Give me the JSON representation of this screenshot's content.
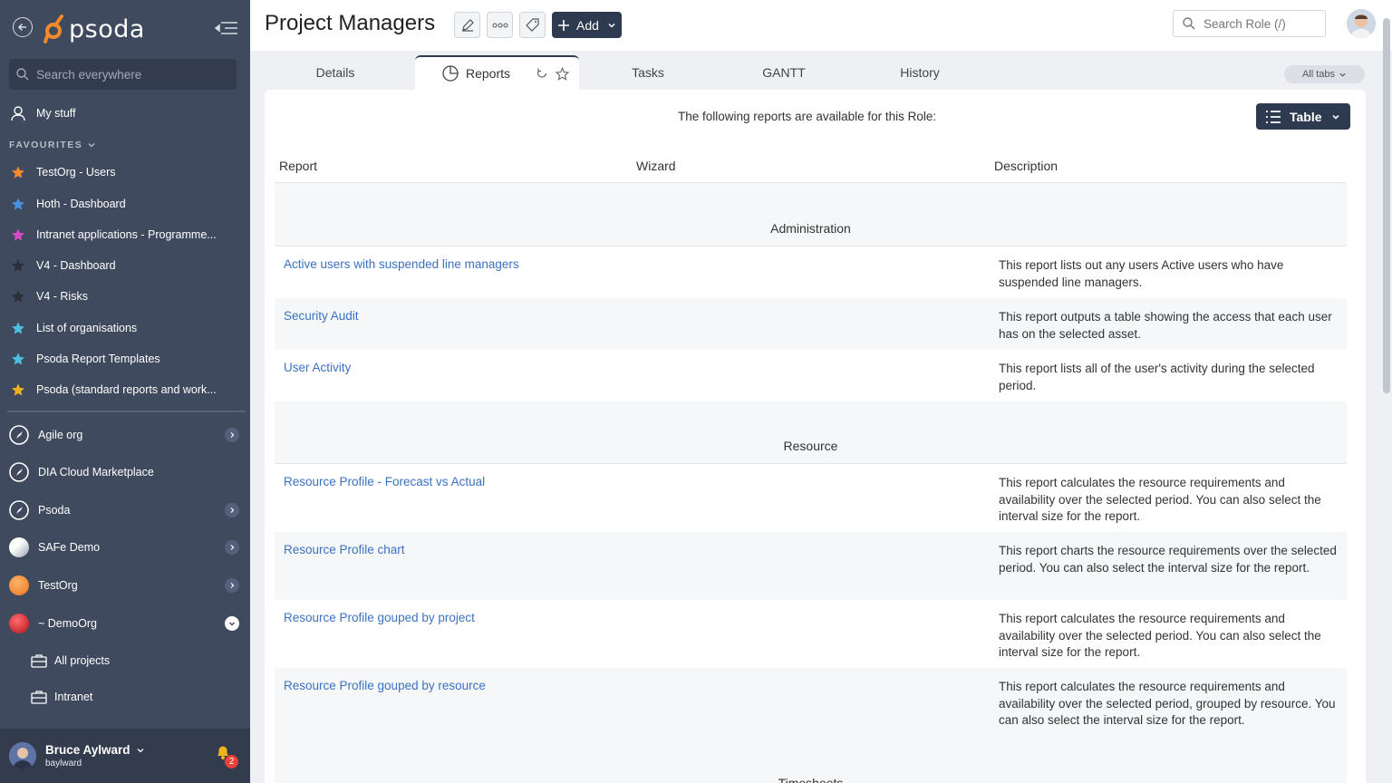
{
  "sidebar": {
    "logo": "psoda",
    "search_placeholder": "Search everywhere",
    "my_stuff": "My stuff",
    "favourites_label": "FAVOURITES",
    "favourites": [
      {
        "label": "TestOrg - Users",
        "color": "#f08a2c"
      },
      {
        "label": "Hoth - Dashboard",
        "color": "#4a8fe0"
      },
      {
        "label": "Intranet applications - Programme...",
        "color": "#d849c6"
      },
      {
        "label": "V4 - Dashboard",
        "color": "#2b2f37"
      },
      {
        "label": "V4 - Risks",
        "color": "#2b2f37"
      },
      {
        "label": "List of organisations",
        "color": "#4bbfe0"
      },
      {
        "label": "Psoda Report Templates",
        "color": "#4bbfe0"
      },
      {
        "label": "Psoda (standard reports and work...",
        "color": "#f0b21c"
      }
    ],
    "orgs": [
      {
        "label": "Agile org",
        "has_arrow": true
      },
      {
        "label": "DIA Cloud Marketplace",
        "has_arrow": false
      },
      {
        "label": "Psoda",
        "has_arrow": true
      },
      {
        "label": "SAFe Demo",
        "has_arrow": true
      },
      {
        "label": "TestOrg",
        "has_arrow": true
      },
      {
        "label": "~ DemoOrg",
        "has_arrow": true,
        "expanded": true
      }
    ],
    "sub_items": [
      {
        "label": "All projects"
      },
      {
        "label": "Intranet"
      }
    ],
    "user": {
      "name": "Bruce Aylward",
      "username": "baylward"
    },
    "notifications": "2"
  },
  "header": {
    "title": "Project Managers",
    "add_label": "Add",
    "search_placeholder": "Search Role (/)"
  },
  "tabs": [
    {
      "label": "Details"
    },
    {
      "label": "Reports",
      "active": true
    },
    {
      "label": "Tasks"
    },
    {
      "label": "GANTT"
    },
    {
      "label": "History"
    }
  ],
  "all_tabs_label": "All tabs",
  "content": {
    "intro": "The following reports are available for this Role:",
    "view_label": "Table",
    "columns": [
      "Report",
      "Wizard",
      "Description"
    ],
    "sections": [
      {
        "name": "Administration",
        "reports": [
          {
            "name": "Active users with suspended line managers",
            "description": "This report lists out any users Active users who have suspended line managers."
          },
          {
            "name": "Security Audit",
            "description": "This report outputs a table showing the access that each user has on the selected asset."
          },
          {
            "name": "User Activity",
            "description": "This report lists all of the user's activity during the selected period."
          }
        ]
      },
      {
        "name": "Resource",
        "reports": [
          {
            "name": "Resource Profile - Forecast vs Actual",
            "description": "This report calculates the resource requirements and availability over the selected period. You can also select the interval size for the report."
          },
          {
            "name": "Resource Profile chart",
            "description": "This report charts the resource requirements over the selected period. You can also select the interval size for the report."
          },
          {
            "name": "Resource Profile gouped by project",
            "description": "This report calculates the resource requirements and availability over the selected period. You can also select the interval size for the report."
          },
          {
            "name": "Resource Profile gouped by resource",
            "description": "This report calculates the resource requirements and availability over the selected period, grouped by resource. You can also select the interval size for the report."
          }
        ]
      },
      {
        "name": "Timesheets",
        "reports": []
      }
    ]
  }
}
